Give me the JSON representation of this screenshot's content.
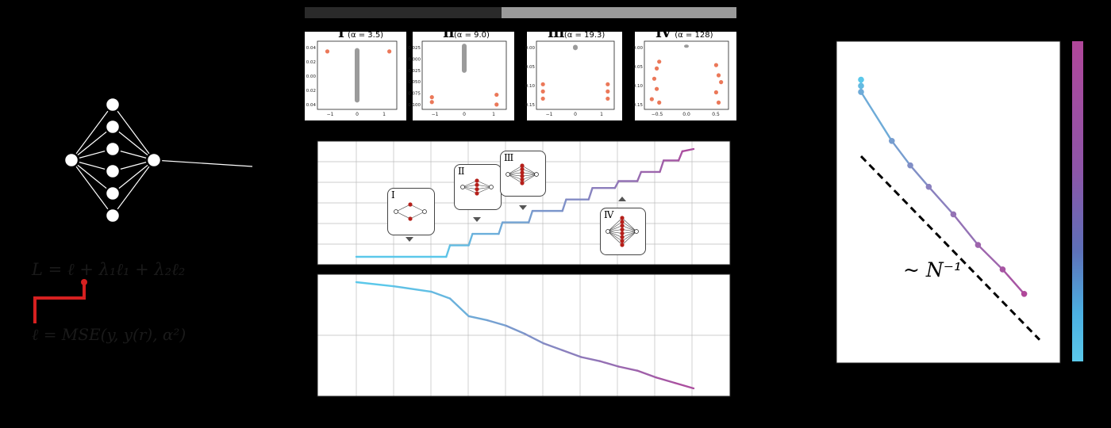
{
  "colors": {
    "background": "#000000",
    "start": "#5bc8ea",
    "end": "#b0479a",
    "scatter_grey": "#8a8a8a",
    "scatter_orange": "#e8603c",
    "node_red": "#b5201b",
    "bracket_red": "#d62020",
    "grid": "#bdbdbd"
  },
  "equations": {
    "loss_total": "L = ℓ + λ₁ℓ₁ + λ₂ℓ₂",
    "loss_task": "ℓ = MSE(y, y(r), α²)",
    "scaling_law": "~ N⁻¹"
  },
  "snapshots": [
    {
      "numeral": "I",
      "alpha": "(α = 3.5)",
      "yticks": [
        "0.04",
        "0.02",
        "0.00",
        "0.02",
        "0.04"
      ],
      "xticks": [
        "−1",
        "0",
        "1"
      ]
    },
    {
      "numeral": "II",
      "alpha": "(α = 9.0)",
      "yticks": [
        "0.025",
        "0.000",
        "0.025",
        "0.050",
        "0.075",
        "0.100"
      ],
      "xticks": [
        "−1",
        "0",
        "1"
      ]
    },
    {
      "numeral": "III",
      "alpha": "(α = 19.3)",
      "yticks": [
        "0.00",
        "0.05",
        "0.10",
        "0.15"
      ],
      "xticks": [
        "−1",
        "0",
        "1"
      ]
    },
    {
      "numeral": "IV",
      "alpha": "(α = 128)",
      "yticks": [
        "0.00",
        "0.05",
        "0.10",
        "0.15"
      ],
      "xticks": [
        "−0.5",
        "0.0",
        "0.5"
      ]
    }
  ],
  "markers": [
    {
      "numeral": "I"
    },
    {
      "numeral": "II"
    },
    {
      "numeral": "III"
    },
    {
      "numeral": "IV"
    }
  ],
  "chart_data": [
    {
      "type": "scatter",
      "panel": "snapshot-I",
      "series": [
        {
          "values": [
            [
              0,
              0.04
            ],
            [
              0,
              -0.04
            ]
          ]
        },
        {
          "values": [
            [
              -1.2,
              -0.035
            ],
            [
              1.3,
              -0.035
            ]
          ]
        }
      ]
    },
    {
      "type": "scatter",
      "panel": "snapshot-II",
      "series": [
        {
          "values": [
            [
              0,
              0.025
            ],
            [
              0,
              -0.035
            ]
          ]
        },
        {
          "values": [
            [
              -1,
              0.075
            ],
            [
              -1,
              0.085
            ],
            [
              1,
              0.07
            ],
            [
              1,
              0.09
            ]
          ]
        }
      ]
    },
    {
      "type": "scatter",
      "panel": "snapshot-III",
      "series": [
        {
          "values": [
            [
              0,
              0.0
            ],
            [
              0,
              0.015
            ]
          ]
        },
        {
          "values": [
            [
              -1,
              0.11
            ],
            [
              -1,
              0.13
            ],
            [
              -1,
              0.15
            ],
            [
              1,
              0.11
            ],
            [
              1,
              0.13
            ],
            [
              1,
              0.15
            ]
          ]
        }
      ]
    },
    {
      "type": "scatter",
      "panel": "snapshot-IV",
      "series": [
        {
          "values": [
            [
              0,
              0.0
            ],
            [
              0,
              0.005
            ]
          ]
        },
        {
          "values": [
            [
              -0.6,
              0.07
            ],
            [
              -0.55,
              0.05
            ],
            [
              -0.65,
              0.1
            ],
            [
              -0.6,
              0.13
            ],
            [
              -0.7,
              0.16
            ],
            [
              -0.55,
              0.17
            ],
            [
              0.6,
              0.06
            ],
            [
              0.65,
              0.09
            ],
            [
              0.7,
              0.11
            ],
            [
              0.6,
              0.14
            ],
            [
              0.65,
              0.17
            ]
          ]
        }
      ]
    },
    {
      "type": "line",
      "panel": "network-size-vs-alpha",
      "x": [
        0,
        2.4,
        2.5,
        3.0,
        3.1,
        3.8,
        3.9,
        4.6,
        4.7,
        5.5,
        5.6,
        6.2,
        6.3,
        6.9,
        7.0,
        7.5,
        7.6,
        8.1,
        8.2,
        8.6,
        8.7,
        9.0
      ],
      "values": [
        0,
        0,
        0.5,
        0.5,
        1,
        1,
        1.5,
        1.5,
        2,
        2,
        2.5,
        2.5,
        3,
        3,
        3.3,
        3.3,
        3.7,
        3.7,
        4.2,
        4.2,
        4.6,
        4.7
      ]
    },
    {
      "type": "line",
      "panel": "loss-vs-alpha",
      "x": [
        0,
        1,
        2,
        2.5,
        3,
        3.5,
        4,
        4.5,
        5,
        5.5,
        6,
        6.5,
        7,
        7.5,
        8,
        8.5,
        9
      ],
      "values": [
        1.0,
        0.97,
        0.93,
        0.88,
        0.75,
        0.72,
        0.68,
        0.62,
        0.55,
        0.5,
        0.45,
        0.42,
        0.38,
        0.35,
        0.3,
        0.26,
        0.22
      ]
    },
    {
      "type": "line",
      "panel": "scaling",
      "series": [
        {
          "x": [
            0,
            0,
            0,
            1,
            1.6,
            2.2,
            3.0,
            3.8,
            4.6,
            5.3
          ],
          "values": [
            0.9,
            0.88,
            0.86,
            0.7,
            0.62,
            0.55,
            0.46,
            0.36,
            0.28,
            0.2
          ]
        },
        {
          "x": [
            0,
            5.8
          ],
          "values": [
            0.65,
            0.05
          ]
        }
      ]
    }
  ]
}
